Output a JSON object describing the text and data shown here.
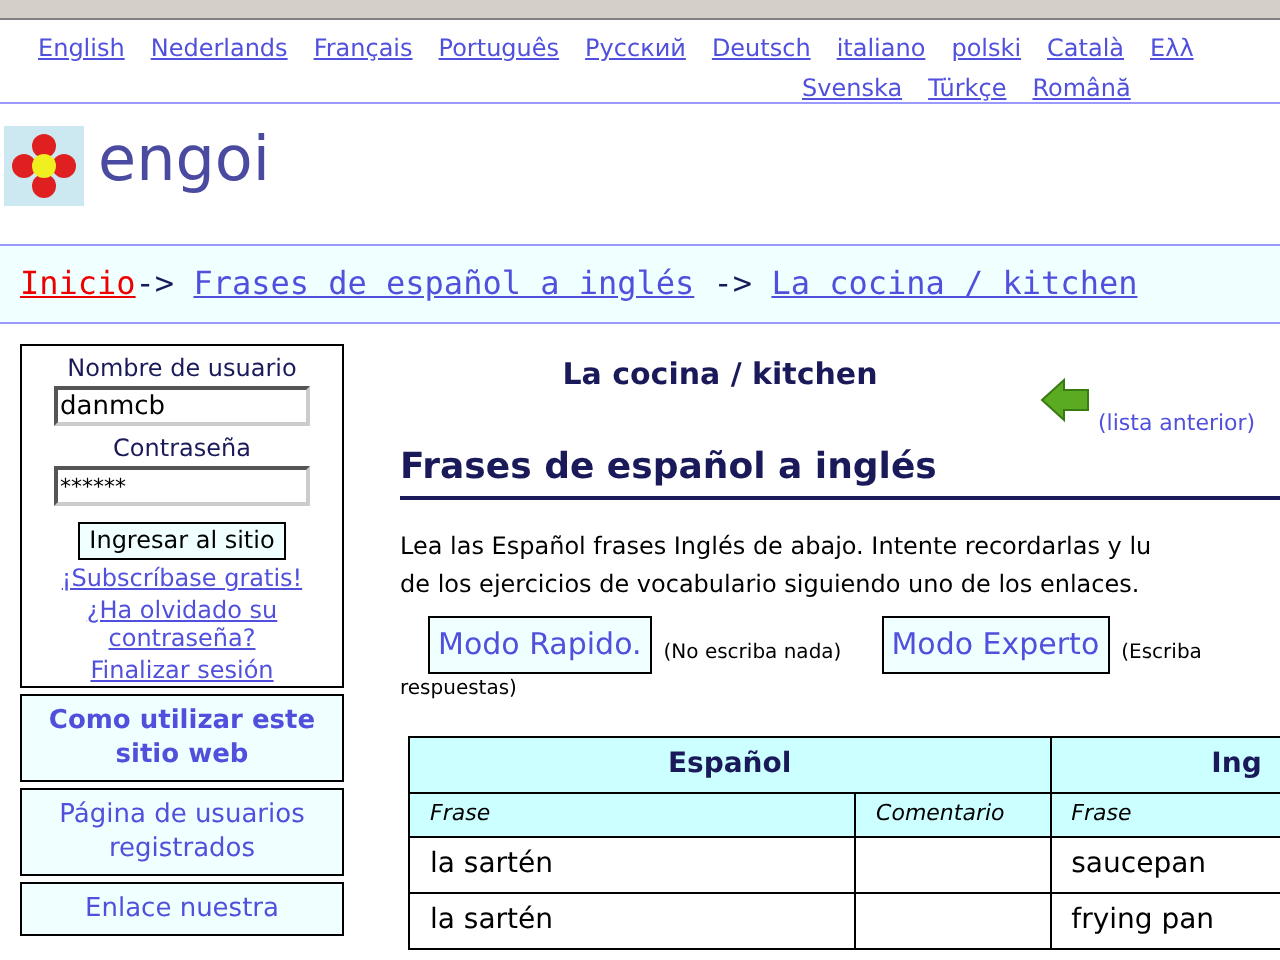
{
  "languages": [
    {
      "label": "English"
    },
    {
      "label": "Nederlands"
    },
    {
      "label": "Français"
    },
    {
      "label": "Português"
    },
    {
      "label": "Русский"
    },
    {
      "label": "Deutsch"
    },
    {
      "label": "italiano"
    },
    {
      "label": "polski"
    },
    {
      "label": "Català"
    },
    {
      "label": "Ελλ"
    }
  ],
  "languages_row_2": [
    {
      "label": "Svenska"
    },
    {
      "label": "Türkçe"
    },
    {
      "label": "Română"
    }
  ],
  "logo": {
    "text": "engoi"
  },
  "breadcrumb": [
    {
      "label": "Inicio",
      "selected": true
    },
    {
      "label": "Frases de español a inglés",
      "selected": false
    },
    {
      "label": "La cocina / kitchen",
      "selected": false
    }
  ],
  "breadcrumb_separator": "->",
  "login": {
    "username_label": "Nombre de usuario",
    "username": "danmcb",
    "password_label": "Contraseña",
    "password": "******",
    "submit": "Ingresar al sitio",
    "links": [
      "¡Subscríbase gratis!",
      "¿Ha olvidado su contraseña?",
      "Finalizar sesión"
    ]
  },
  "sidebar": {
    "items": [
      {
        "label": "Como utilizar este sitio web",
        "bold": true
      },
      {
        "label": "Página de usuarios registrados",
        "bold": false
      },
      {
        "label": "Enlace nuestra",
        "bold": false
      }
    ]
  },
  "list_title": "La cocina / kitchen",
  "previous_list": "(lista anterior)",
  "heading": "Frases de español a inglés",
  "intro": "Lea las Español frases Inglés de abajo. Intente recordarlas y lu",
  "intro_2": "de los ejercicios de vocabulario siguiendo uno de los enlaces.",
  "modes": [
    {
      "label": "Modo Rapido.",
      "note": "(No escriba nada)"
    },
    {
      "label": "Modo Experto",
      "note": "(Escriba"
    }
  ],
  "modes_note_2": "respuestas)",
  "table": {
    "groups": [
      "Español",
      "Ing"
    ],
    "columns": [
      "Frase",
      "Comentario",
      "Frase"
    ],
    "rows": [
      [
        "la sartén",
        "",
        "saucepan"
      ],
      [
        "la sartén",
        "",
        "frying pan"
      ]
    ]
  }
}
